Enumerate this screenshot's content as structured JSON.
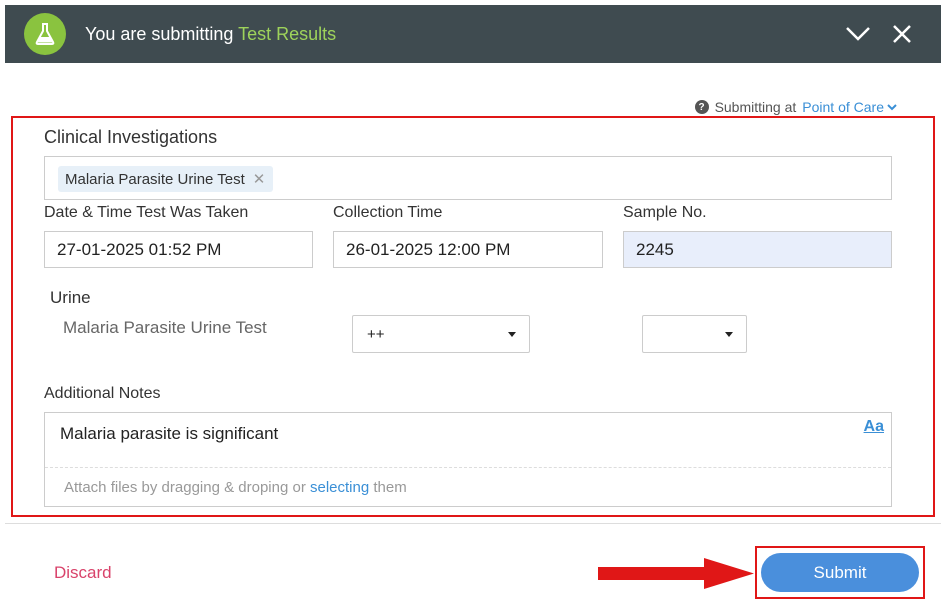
{
  "header": {
    "title_prefix": "You are submitting",
    "title_highlight": "Test Results",
    "logo_icon": "flask-icon",
    "collapse_icon": "chevron-down-icon",
    "close_icon": "close-icon"
  },
  "submitting_at": {
    "label": "Submitting at",
    "location": "Point of Care"
  },
  "form": {
    "clinical_investigations_label": "Clinical Investigations",
    "investigation_tag": "Malaria Parasite Urine Test",
    "date_taken_label": "Date & Time Test Was Taken",
    "date_taken_value": "27-01-2025 01:52 PM",
    "collection_time_label": "Collection Time",
    "collection_time_value": "26-01-2025 12:00 PM",
    "sample_no_label": "Sample No.",
    "sample_no_value": "2245",
    "section_label": "Urine",
    "test_label": "Malaria Parasite Urine Test",
    "result_value": "++",
    "unit_value": "",
    "notes_label": "Additional Notes",
    "notes_value": "Malaria parasite is significant",
    "format_button": "Aa",
    "attach_prefix": "Attach files by dragging & droping or",
    "attach_link": "selecting",
    "attach_suffix": "them"
  },
  "footer": {
    "discard_label": "Discard",
    "submit_label": "Submit"
  },
  "colors": {
    "header_bg": "#3f4b50",
    "accent_green": "#8ac33f",
    "link_blue": "#3a8fd6",
    "submit_blue": "#4a8fdc",
    "discard_pink": "#d9436b",
    "annotation_red": "#e01717"
  }
}
